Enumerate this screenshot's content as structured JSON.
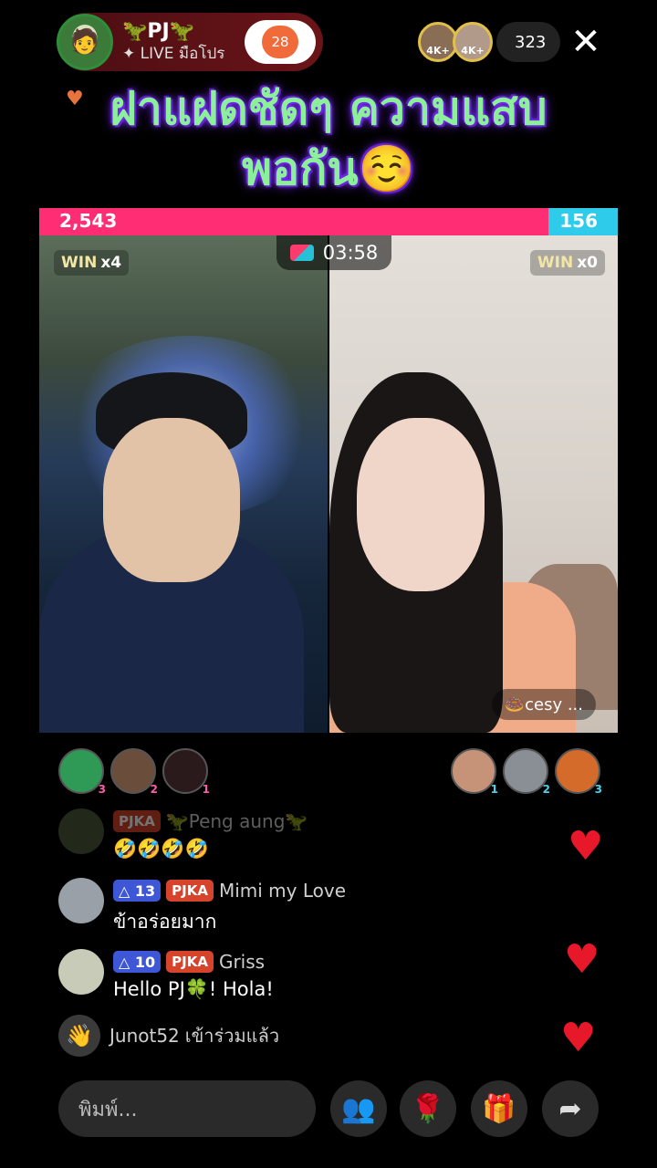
{
  "host": {
    "name": "🦖PJ🦖",
    "subtitle": "✦ LIVE มือโปร",
    "follow_count": "28"
  },
  "viewers": {
    "avatars": [
      {
        "badge": "4K+"
      },
      {
        "badge": "4K+"
      }
    ],
    "count": "323"
  },
  "headline": "ฝาแฝดชัดๆ ความแสบพอกัน☺️",
  "battle": {
    "score_left": "2,543",
    "score_right": "156",
    "timer": "03:58",
    "left_win_label": "WIN",
    "left_win_mult": "x4",
    "right_win_label": "WIN",
    "right_win_mult": "x0",
    "guest_name": "🍩cesy ..."
  },
  "supporters_left": [
    {
      "rank": "3",
      "color": "#2f9a55"
    },
    {
      "rank": "2",
      "color": "#6a4d3a"
    },
    {
      "rank": "1",
      "color": "#2b1a1c"
    }
  ],
  "supporters_right": [
    {
      "rank": "1",
      "color": "#c79378"
    },
    {
      "rank": "2",
      "color": "#8a8f96"
    },
    {
      "rank": "3",
      "color": "#d46b2b"
    }
  ],
  "chat": [
    {
      "fan": "PJKA",
      "user": "🦖Peng aung🦖",
      "text": "🤣🤣🤣🤣"
    },
    {
      "level": "△ 13",
      "fan": "PJKA",
      "user": "Mimi my Love",
      "text": "ข้าอร่อยมาก"
    },
    {
      "level": "△ 10",
      "fan": "PJKA",
      "user": "Griss",
      "text": "Hello PJ🍀! Hola!"
    },
    {
      "user": "Junot52",
      "text": "เข้าร่วมแล้ว"
    }
  ],
  "input": {
    "placeholder": "พิมพ์..."
  },
  "colors": {
    "battle_pink": "#ff2d73",
    "battle_blue": "#2ecbea",
    "heart": "#e8182b"
  }
}
